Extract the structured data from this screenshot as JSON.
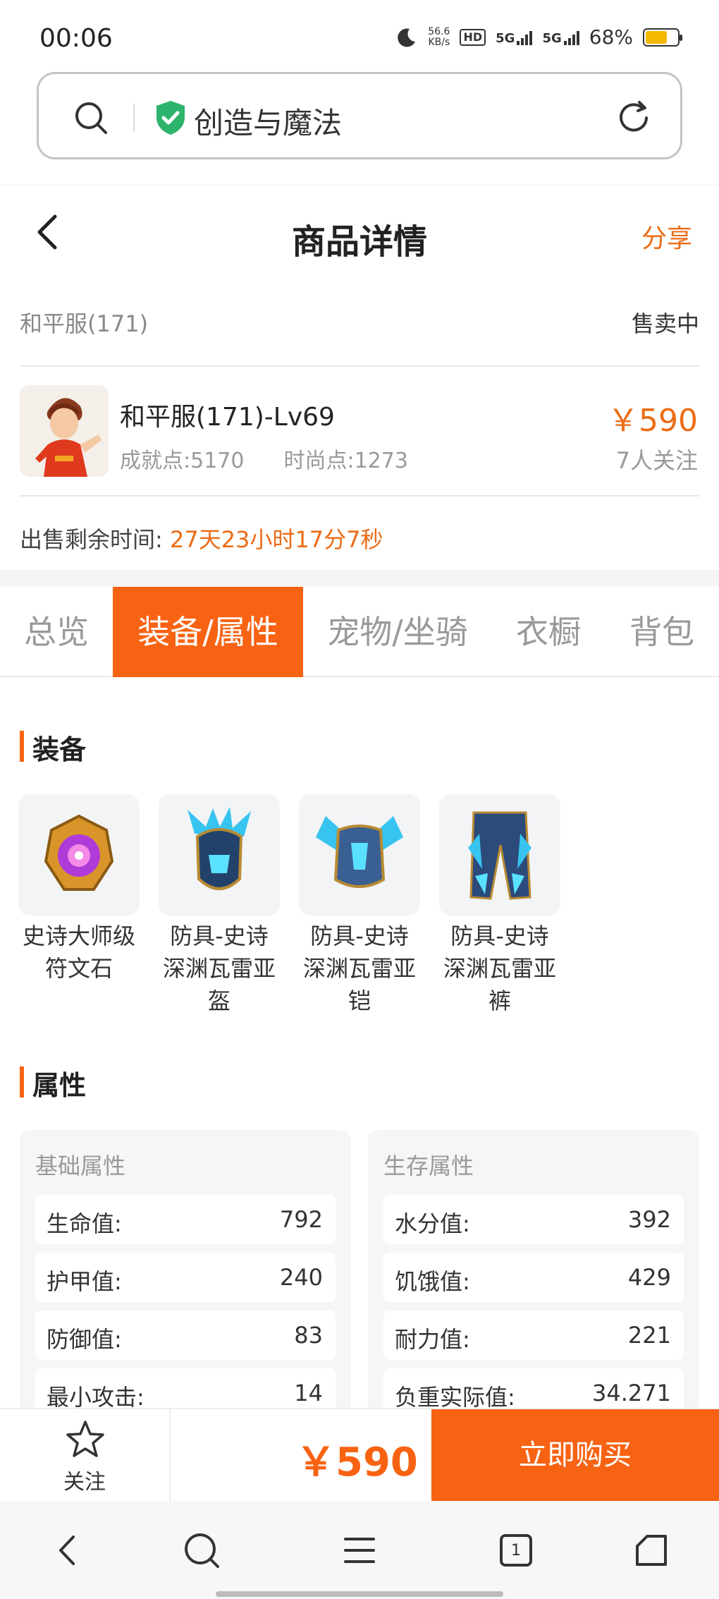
{
  "status_bar": {
    "time": "00:06",
    "net_speed_value": "56.6",
    "net_speed_unit": "KB/s",
    "sim1": "5G",
    "sim2": "5G",
    "hd": "HD",
    "battery": "68%",
    "battery_level": 0.68
  },
  "url_bar": {
    "text": "创造与魔法",
    "icons": [
      "search-icon",
      "shield-check-icon",
      "refresh-icon"
    ]
  },
  "header": {
    "title": "商品详情",
    "share": "分享",
    "back_icon": "chevron-left-icon"
  },
  "listing": {
    "server": "和平服(171)",
    "status": "售卖中",
    "name": "和平服(171)-Lv69",
    "achievement": "成就点:5170",
    "fashion": "时尚点:1273",
    "price": "￥590",
    "followers": "7人关注",
    "time_label": "出售剩余时间:",
    "time_value": "27天23小时17分7秒"
  },
  "tabs": [
    {
      "label": "总览",
      "active": false
    },
    {
      "label": "装备/属性",
      "active": true
    },
    {
      "label": "宠物/坐骑",
      "active": false
    },
    {
      "label": "衣橱",
      "active": false
    },
    {
      "label": "背包",
      "active": false
    }
  ],
  "equipment": {
    "title": "装备",
    "items": [
      {
        "line1": "史诗大师级",
        "line2": "符文石",
        "line3": ""
      },
      {
        "line1": "防具-史诗",
        "line2": "深渊瓦雷亚",
        "line3": "盔"
      },
      {
        "line1": "防具-史诗",
        "line2": "深渊瓦雷亚",
        "line3": "铠"
      },
      {
        "line1": "防具-史诗",
        "line2": "深渊瓦雷亚",
        "line3": "裤"
      }
    ]
  },
  "attributes": {
    "title": "属性",
    "basic": {
      "title": "基础属性",
      "rows": [
        {
          "k": "生命值:",
          "v": "792"
        },
        {
          "k": "护甲值:",
          "v": "240"
        },
        {
          "k": "防御值:",
          "v": "83"
        },
        {
          "k": "最小攻击:",
          "v": "14"
        }
      ]
    },
    "survival": {
      "title": "生存属性",
      "rows": [
        {
          "k": "水分值:",
          "v": "392"
        },
        {
          "k": "饥饿值:",
          "v": "429"
        },
        {
          "k": "耐力值:",
          "v": "221"
        },
        {
          "k": "负重实际值:",
          "v": "34.271"
        }
      ]
    }
  },
  "purchase_bar": {
    "follow": "关注",
    "price": "￥590",
    "buy": "立即购买"
  },
  "nav_bar": {
    "tab_count": "1",
    "icons": [
      "back-icon",
      "search-icon",
      "menu-icon",
      "tabs-icon",
      "home-icon"
    ]
  },
  "colors": {
    "accent": "#f86313",
    "price": "#ec6c16",
    "shield": "#2db36b",
    "battery": "#f5b800"
  }
}
